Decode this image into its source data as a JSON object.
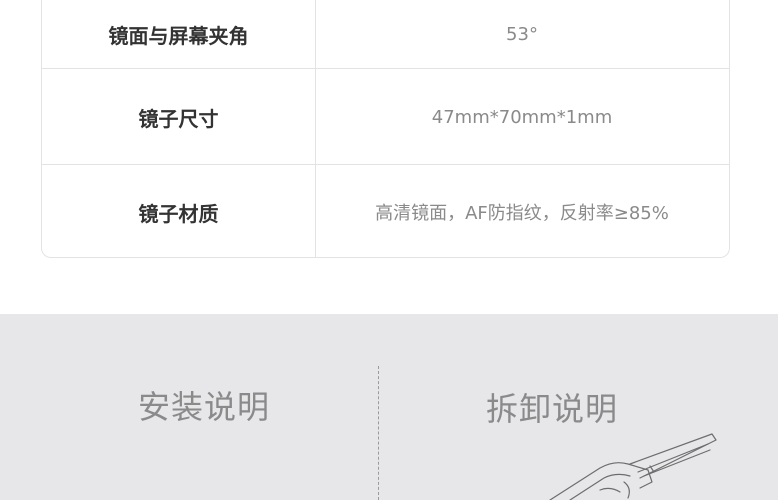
{
  "spec_table": {
    "rows": [
      {
        "label": "镜面与屏幕夹角",
        "value": "53°"
      },
      {
        "label": "镜子尺寸",
        "value": "47mm*70mm*1mm"
      },
      {
        "label": "镜子材质",
        "value": "高清镜面，AF防指纹，反射率≥85%"
      }
    ]
  },
  "install_section": {
    "install_title": "安装说明",
    "remove_title": "拆卸说明"
  },
  "colors": {
    "section_background": "#e7e7ea",
    "border": "#e3e3e3",
    "label_text": "#333333",
    "value_text": "#8a8a8a"
  }
}
